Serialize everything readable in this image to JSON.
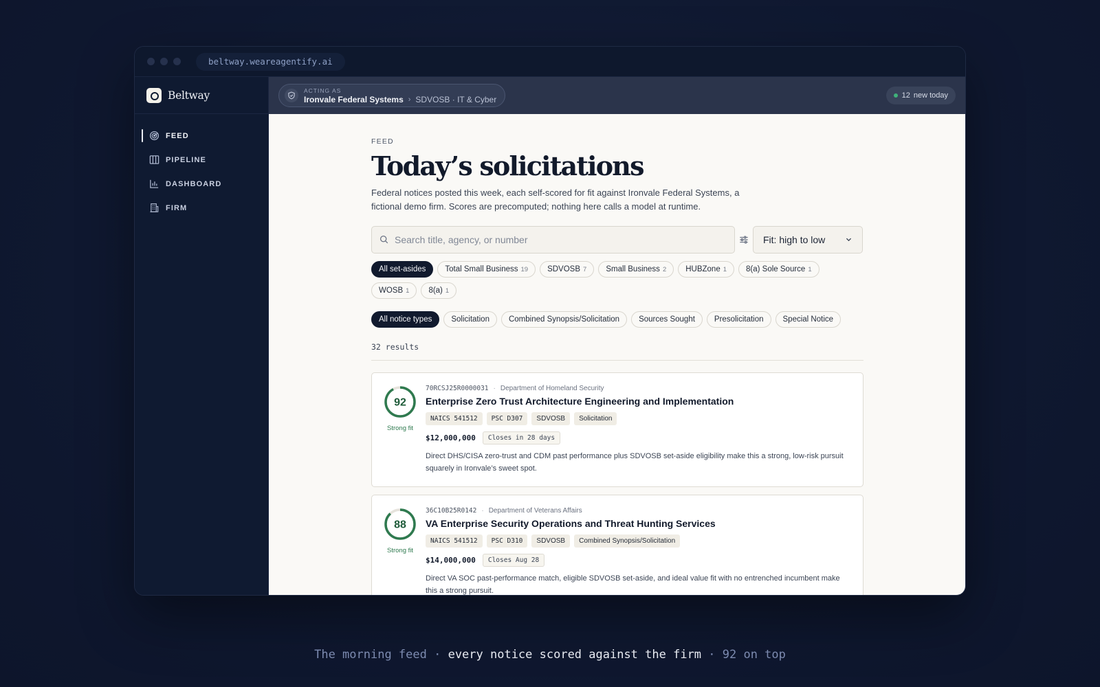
{
  "browser": {
    "url": "beltway.weareagentify.ai"
  },
  "sidebar": {
    "brand": "Beltway",
    "items": [
      {
        "label": "FEED",
        "icon": "radar-icon",
        "active": true
      },
      {
        "label": "PIPELINE",
        "icon": "columns-icon",
        "active": false
      },
      {
        "label": "DASHBOARD",
        "icon": "bar-chart-icon",
        "active": false
      },
      {
        "label": "FIRM",
        "icon": "building-icon",
        "active": false
      }
    ]
  },
  "topbar": {
    "acting_label": "ACTING AS",
    "firm": "Ironvale Federal Systems",
    "classification": "SDVOSB · IT & Cyber",
    "new_count": "12",
    "new_label": "new today"
  },
  "page": {
    "eyebrow": "FEED",
    "title": "Today’s solicitations",
    "lede": "Federal notices posted this week, each self-scored for fit against Ironvale Federal Systems, a fictional demo firm. Scores are precomputed; nothing here calls a model at runtime."
  },
  "search": {
    "placeholder": "Search title, agency, or number",
    "value": ""
  },
  "sort": {
    "selected": "Fit: high to low"
  },
  "setaside_filters": [
    {
      "label": "All set-asides",
      "count": "",
      "active": true
    },
    {
      "label": "Total Small Business",
      "count": "19",
      "active": false
    },
    {
      "label": "SDVOSB",
      "count": "7",
      "active": false
    },
    {
      "label": "Small Business",
      "count": "2",
      "active": false
    },
    {
      "label": "HUBZone",
      "count": "1",
      "active": false
    },
    {
      "label": "8(a) Sole Source",
      "count": "1",
      "active": false
    },
    {
      "label": "WOSB",
      "count": "1",
      "active": false
    },
    {
      "label": "8(a)",
      "count": "1",
      "active": false
    }
  ],
  "type_filters": [
    {
      "label": "All notice types",
      "active": true
    },
    {
      "label": "Solicitation",
      "active": false
    },
    {
      "label": "Combined Synopsis/Solicitation",
      "active": false
    },
    {
      "label": "Sources Sought",
      "active": false
    },
    {
      "label": "Presolicitation",
      "active": false
    },
    {
      "label": "Special Notice",
      "active": false
    }
  ],
  "results_label": "32 results",
  "opportunities": [
    {
      "score": "92",
      "score_fraction": 0.92,
      "score_label": "Strong fit",
      "number": "70RCSJ25R0000031",
      "agency": "Department of Homeland Security",
      "title": "Enterprise Zero Trust Architecture Engineering and Implementation",
      "tags": [
        "NAICS 541512",
        "PSC D307",
        "SDVOSB",
        "Solicitation"
      ],
      "value": "$12,000,000",
      "closes": "Closes in 28 days",
      "rationale": "Direct DHS/CISA zero-trust and CDM past performance plus SDVOSB set-aside eligibility make this a strong, low-risk pursuit squarely in Ironvale’s sweet spot."
    },
    {
      "score": "88",
      "score_fraction": 0.88,
      "score_label": "Strong fit",
      "number": "36C10B25R0142",
      "agency": "Department of Veterans Affairs",
      "title": "VA Enterprise Security Operations and Threat Hunting Services",
      "tags": [
        "NAICS 541512",
        "PSC D310",
        "SDVOSB",
        "Combined Synopsis/Solicitation"
      ],
      "value": "$14,000,000",
      "closes": "Closes Aug 28",
      "rationale": "Direct VA SOC past-performance match, eligible SDVOSB set-aside, and ideal value fit with no entrenched incumbent make this a strong pursuit."
    }
  ],
  "caption": {
    "part1": "The morning feed · ",
    "part2": "every notice scored against the firm",
    "part3": " · 92 on top"
  },
  "colors": {
    "accent_dark": "#111a2e",
    "fit_green": "#2f7a4f",
    "sidebar_bg": "#0f1a31"
  }
}
